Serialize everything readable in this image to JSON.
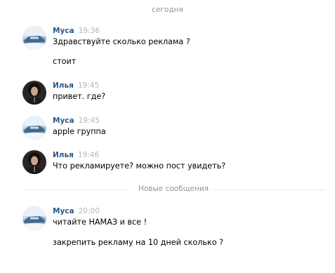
{
  "date_separator": "сегодня",
  "new_messages_separator": "Новые сообщения",
  "messages": [
    {
      "author": "Муса",
      "time": "19:36",
      "lines": [
        "Здравствуйте сколько реклама ?",
        "стоит"
      ]
    },
    {
      "author": "Илья",
      "time": "19:45",
      "lines": [
        "привет. где?"
      ]
    },
    {
      "author": "Муса",
      "time": "19:45",
      "lines": [
        "apple группа"
      ]
    },
    {
      "author": "Илья",
      "time": "19:46",
      "lines": [
        "Что рекламируете? можно пост увидеть?"
      ]
    },
    {
      "author": "Муса",
      "time": "20:00",
      "lines": [
        "читайте НАМАЗ и все !",
        "закрепить рекламу на 10 дней сколько ?"
      ]
    }
  ],
  "colors": {
    "author": "#2a5885",
    "time": "#b6b6b6",
    "separator_text": "#939393",
    "separator_line": "#e7e8ec"
  },
  "icons": {
    "musa_avatar": "winter-car-avatar",
    "ilya_avatar": "person-portrait-avatar"
  }
}
